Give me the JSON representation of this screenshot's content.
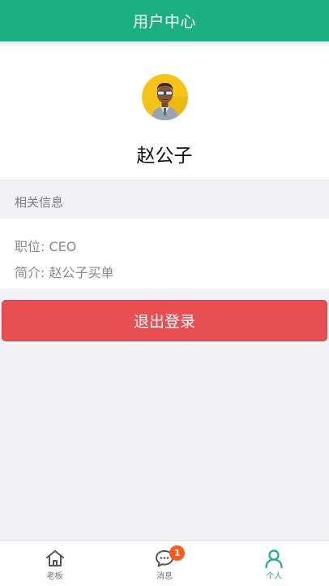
{
  "header": {
    "title": "用户中心"
  },
  "profile": {
    "name": "赵公子"
  },
  "info": {
    "section_title": "相关信息",
    "position": "职位: CEO",
    "intro": "简介: 赵公子买单"
  },
  "logout_label": "退出登录",
  "tabbar": {
    "tabs": [
      {
        "label": "老板",
        "icon": "home-icon"
      },
      {
        "label": "消息",
        "icon": "message-icon",
        "badge": "1"
      },
      {
        "label": "个人",
        "icon": "person-icon",
        "active": true
      }
    ]
  },
  "colors": {
    "primary": "#1caf7f",
    "danger": "#e84f52",
    "badge": "#ff5a1f"
  }
}
